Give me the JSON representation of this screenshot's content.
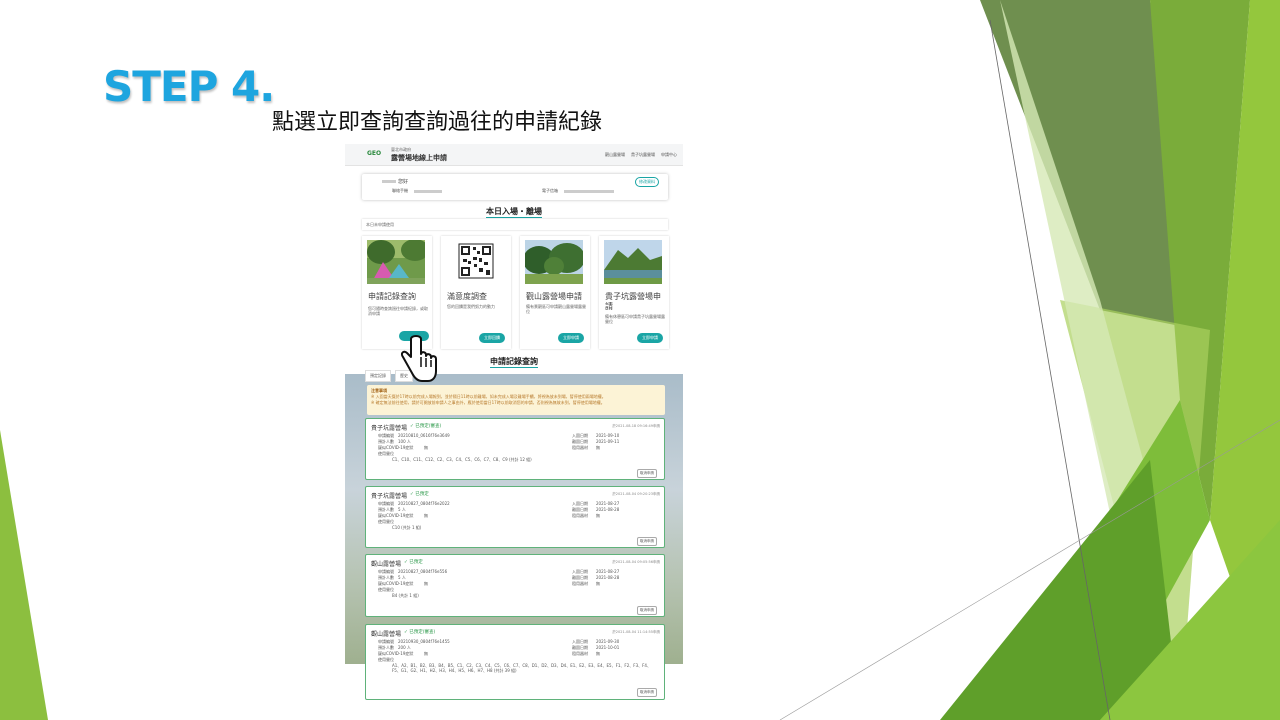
{
  "slide": {
    "step_title": "STEP 4.",
    "subtitle": "點選立即查詢查詢過往的申請紀錄",
    "accent": "#1ea5df"
  },
  "site": {
    "logo": "GEO",
    "org": "臺北市政府",
    "name": "露營場地線上申請",
    "nav": [
      "觀山露營場",
      "貴子坑露營場",
      "申請中心"
    ]
  },
  "profile": {
    "name_suffix": "您好",
    "phone_label": "聯絡手機",
    "email_label": "電子信箱",
    "edit_button": "修改資料"
  },
  "today_section": {
    "title": "本日入場・離場",
    "empty_text": "本日未申請使用"
  },
  "cards": [
    {
      "title": "申請記錄查詢",
      "desc": "您可隨時查詢過往申請紀錄，或取消申請",
      "button": "",
      "icon": "tent-photo"
    },
    {
      "title": "滿意度調查",
      "desc": "您的回饋是我們努力的動力",
      "button": "立即回饋",
      "icon": "qr-code-icon"
    },
    {
      "title": "觀山露營場申請",
      "desc": "備有景觀區可申請觀山露營場露營位",
      "button": "立即申請",
      "icon": "park-photo"
    },
    {
      "title": "貴子坑露營場申請",
      "desc": "備有休憩區可申請貴子坑露營場露營位",
      "button": "立即申請",
      "icon": "lake-photo"
    }
  ],
  "records_section": {
    "title": "申請記錄查詢",
    "tabs": [
      "預定記錄",
      "歷史"
    ],
    "notice_title": "注意事項",
    "notice_lines": [
      "※ 入園當天擬於17時以前完成入場報到，並於隔日11時以前離場，如未完成入場及離場手續，將視為放未到場，暫停使用兩場地權。",
      "※ 確定無法前往使用，請於可開放前申請人之事由外，應於使用當日17時以前取消您的申請，否則視為無故未到，暫停使用場地權。"
    ]
  },
  "records": [
    {
      "site": "貴子坑露營場",
      "status": "已預定(審查)",
      "date": "於2021-08-18 09:16:49申請",
      "app_no": "20210810_0616f76e3649",
      "people": "100 人",
      "covid": "無",
      "in_date": "2021-09-10",
      "out_date": "2021-09-11",
      "rental": "無",
      "seats": "C1、C10、C11、C12、C2、C3、C4、C5、C6、C7、C8、C9  (共計 12 組)"
    },
    {
      "site": "貴子坑露營場",
      "status": "已預定",
      "date": "於2021-08-04 09:20:23申請",
      "app_no": "20210827_0804f76e2022",
      "people": "5 人",
      "covid": "無",
      "in_date": "2021-08-27",
      "out_date": "2021-08-28",
      "rental": "無",
      "seats": "C10  (共計 1 組)"
    },
    {
      "site": "觀山露營場",
      "status": "已預定",
      "date": "於2021-08-04 09:05:56申請",
      "app_no": "20210827_0804f76e556",
      "people": "5 人",
      "covid": "無",
      "in_date": "2021-08-27",
      "out_date": "2021-08-28",
      "rental": "無",
      "seats": "B4  (共計 1 組)"
    },
    {
      "site": "觀山露營場",
      "status": "已預定(審查)",
      "date": "於2021-08-04 11:14:55申請",
      "app_no": "20210930_0804f76e1455",
      "people": "200 人",
      "covid": "無",
      "in_date": "2021-09-30",
      "out_date": "2021-10-01",
      "rental": "無",
      "seats": "A1、A2、B1、B2、B3、B4、B5、C1、C2、C3、C4、C5、C6、C7、C8、D1、D2、D3、D4、E1、E2、E3、E4、E5、F1、F2、F3、F4、F5、G1、G2、H1、H2、H3、H4、H5、H6、H7、H8  (共計 39 組)"
    }
  ],
  "labels": {
    "app_no": "申請編號",
    "people": "預計人數",
    "covid": "疑似COVID-19症狀",
    "seats": "使用營位",
    "in_date": "入園日期",
    "out_date": "離園日期",
    "rental": "租用器材",
    "cancel": "取消申請"
  }
}
